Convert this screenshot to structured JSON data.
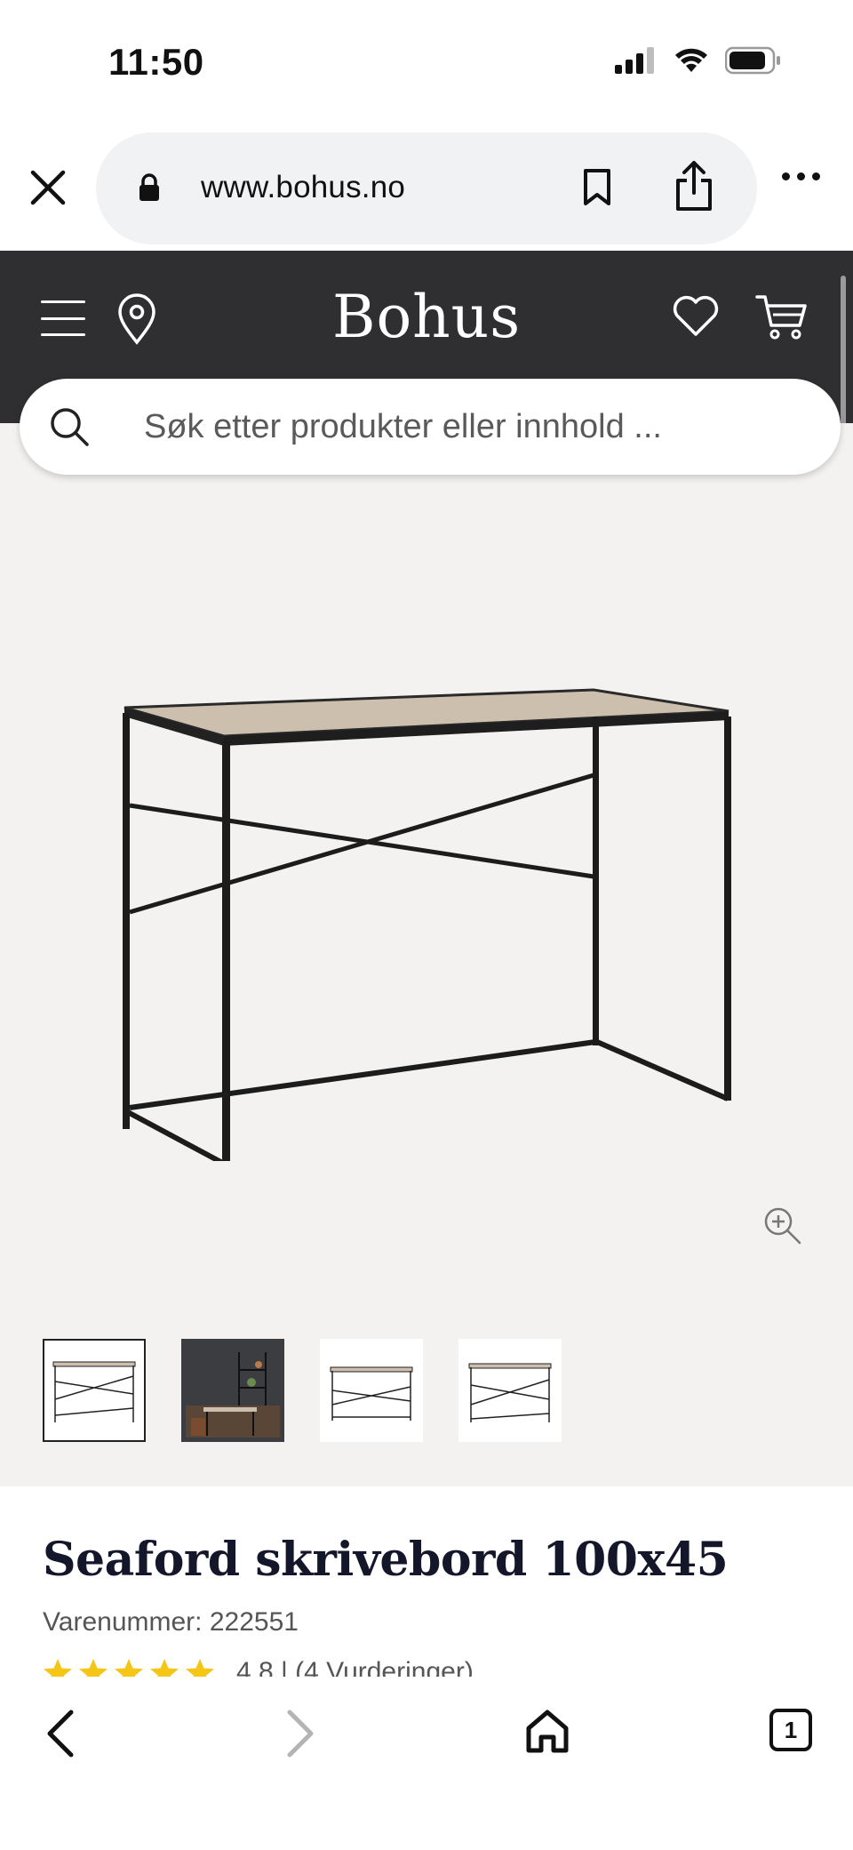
{
  "status_bar": {
    "time": "11:50"
  },
  "browser": {
    "url": "www.bohus.no",
    "tab_count": "1"
  },
  "site": {
    "brand": "Bohus",
    "search_placeholder": "Søk etter produkter eller innhold ..."
  },
  "product": {
    "title": "Seaford skrivebord 100x45",
    "sku": "Varenummer: 222551",
    "rating": "4,8 | (4 Vurderinger)",
    "stars": 5,
    "thumbnails": [
      "desk-front",
      "desk-room-scene",
      "desk-side",
      "desk-angle"
    ],
    "selected_thumbnail": 0
  },
  "colors": {
    "header_bg": "#2f2f32",
    "image_bg": "#f4f2f0",
    "star": "#f5c518",
    "title": "#14162a"
  }
}
